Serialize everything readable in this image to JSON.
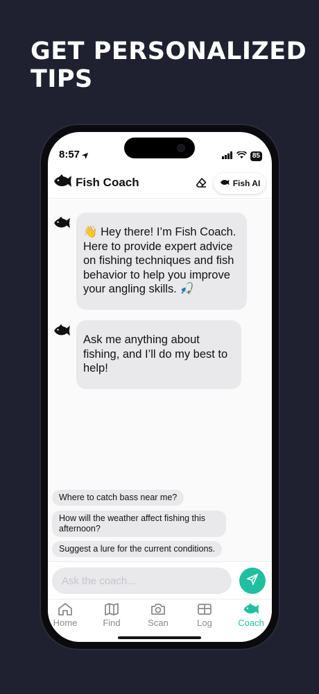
{
  "headline": {
    "line1": "GET PERSONALIZED",
    "line2": "TIPS"
  },
  "status": {
    "time": "8:57",
    "battery": "85"
  },
  "appbar": {
    "title": "Fish Coach",
    "ai_button": "Fish AI"
  },
  "messages": [
    {
      "text": "👋 Hey there! I’m Fish Coach. Here to provide expert advice on fishing techniques and fish behavior to help you improve your angling skills. 🎣"
    },
    {
      "text": "Ask me anything about fishing, and I’ll do my best to help!"
    }
  ],
  "suggestions": [
    "Where to catch bass near me?",
    "How will the weather affect fishing this afternoon?",
    "Suggest a lure for the current conditions."
  ],
  "input": {
    "placeholder": "Ask the coach..."
  },
  "tabs": [
    {
      "label": "Home",
      "icon": "home-icon"
    },
    {
      "label": "Find",
      "icon": "map-icon"
    },
    {
      "label": "Scan",
      "icon": "camera-icon"
    },
    {
      "label": "Log",
      "icon": "log-icon"
    },
    {
      "label": "Coach",
      "icon": "fish-icon",
      "active": true
    }
  ],
  "colors": {
    "accent": "#21bfa0",
    "background": "#1f2030",
    "bubble": "#e9e9eb"
  }
}
